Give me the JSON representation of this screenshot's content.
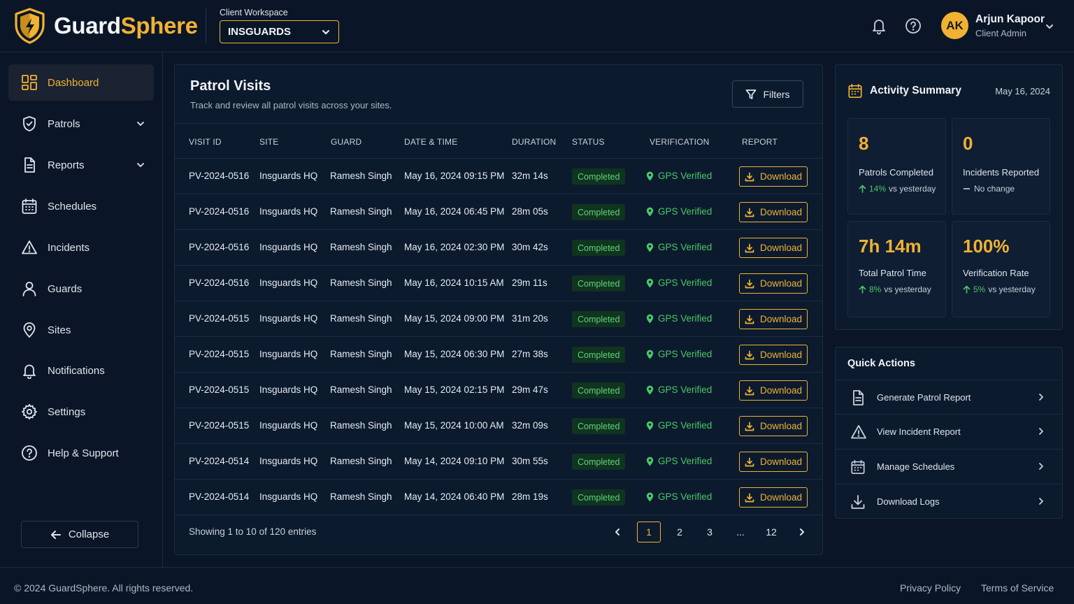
{
  "brand": {
    "name_part1": "Guard",
    "name_part2": "Sphere",
    "accent_color": "#f1b233",
    "logo_icon": "shield-bolt-icon"
  },
  "workspace": {
    "label": "Client Workspace",
    "value": "INSGUARDS"
  },
  "user": {
    "initials": "AK",
    "name": "Arjun Kapoor",
    "role": "Client Admin"
  },
  "topbar_icons": [
    "bell-icon",
    "help-icon"
  ],
  "sidebar": {
    "items": [
      {
        "label": "Dashboard",
        "icon": "dashboard-icon",
        "active": true
      },
      {
        "label": "Patrols",
        "icon": "shield-check-icon",
        "expandable": true
      },
      {
        "label": "Reports",
        "icon": "document-icon",
        "expandable": true
      },
      {
        "label": "Schedules",
        "icon": "calendar-icon"
      },
      {
        "label": "Incidents",
        "icon": "warning-icon"
      },
      {
        "label": "Guards",
        "icon": "user-icon"
      },
      {
        "label": "Sites",
        "icon": "location-pin-icon"
      },
      {
        "label": "Notifications",
        "icon": "bell-icon"
      },
      {
        "label": "Settings",
        "icon": "gear-icon"
      },
      {
        "label": "Help & Support",
        "icon": "help-icon"
      }
    ],
    "collapse_label": "Collapse"
  },
  "patrols": {
    "title": "Patrol Visits",
    "subtitle": "Track and review all patrol visits across your sites.",
    "filters_label": "Filters",
    "columns": [
      "VISIT ID",
      "SITE",
      "GUARD",
      "DATE & TIME",
      "DURATION",
      "STATUS",
      "VERIFICATION",
      "REPORT"
    ],
    "rows": [
      {
        "id": "PV-2024-0516",
        "site": "Insguards HQ",
        "guard": "Ramesh Singh",
        "datetime": "May 16, 2024 09:15 PM",
        "duration": "32m 14s",
        "status": "Completed",
        "verification": "GPS Verified",
        "report": "Download"
      },
      {
        "id": "PV-2024-0516",
        "site": "Insguards HQ",
        "guard": "Ramesh Singh",
        "datetime": "May 16, 2024 06:45 PM",
        "duration": "28m 05s",
        "status": "Completed",
        "verification": "GPS Verified",
        "report": "Download"
      },
      {
        "id": "PV-2024-0516",
        "site": "Insguards HQ",
        "guard": "Ramesh Singh",
        "datetime": "May 16, 2024 02:30 PM",
        "duration": "30m 42s",
        "status": "Completed",
        "verification": "GPS Verified",
        "report": "Download"
      },
      {
        "id": "PV-2024-0516",
        "site": "Insguards HQ",
        "guard": "Ramesh Singh",
        "datetime": "May 16, 2024 10:15 AM",
        "duration": "29m 11s",
        "status": "Completed",
        "verification": "GPS Verified",
        "report": "Download"
      },
      {
        "id": "PV-2024-0515",
        "site": "Insguards HQ",
        "guard": "Ramesh Singh",
        "datetime": "May 15, 2024 09:00 PM",
        "duration": "31m 20s",
        "status": "Completed",
        "verification": "GPS Verified",
        "report": "Download"
      },
      {
        "id": "PV-2024-0515",
        "site": "Insguards HQ",
        "guard": "Ramesh Singh",
        "datetime": "May 15, 2024 06:30 PM",
        "duration": "27m 38s",
        "status": "Completed",
        "verification": "GPS Verified",
        "report": "Download"
      },
      {
        "id": "PV-2024-0515",
        "site": "Insguards HQ",
        "guard": "Ramesh Singh",
        "datetime": "May 15, 2024 02:15 PM",
        "duration": "29m 47s",
        "status": "Completed",
        "verification": "GPS Verified",
        "report": "Download"
      },
      {
        "id": "PV-2024-0515",
        "site": "Insguards HQ",
        "guard": "Ramesh Singh",
        "datetime": "May 15, 2024 10:00 AM",
        "duration": "32m 09s",
        "status": "Completed",
        "verification": "GPS Verified",
        "report": "Download"
      },
      {
        "id": "PV-2024-0514",
        "site": "Insguards HQ",
        "guard": "Ramesh Singh",
        "datetime": "May 14, 2024 09:10 PM",
        "duration": "30m 55s",
        "status": "Completed",
        "verification": "GPS Verified",
        "report": "Download"
      },
      {
        "id": "PV-2024-0514",
        "site": "Insguards HQ",
        "guard": "Ramesh Singh",
        "datetime": "May 14, 2024 06:40 PM",
        "duration": "28m 19s",
        "status": "Completed",
        "verification": "GPS Verified",
        "report": "Download"
      }
    ],
    "showing": "Showing 1 to 10 of 120 entries",
    "pages": [
      "1",
      "2",
      "3",
      "...",
      "12"
    ],
    "current_page": "1"
  },
  "summary": {
    "title": "Activity Summary",
    "date": "May 16, 2024",
    "stats": [
      {
        "value": "8",
        "label": "Patrols Completed",
        "trend_pct": "14%",
        "trend_text": "vs yesterday",
        "trend": "up"
      },
      {
        "value": "0",
        "label": "Incidents Reported",
        "trend_pct": "",
        "trend_text": "No change",
        "trend": "flat"
      },
      {
        "value": "7h 14m",
        "label": "Total Patrol Time",
        "trend_pct": "8%",
        "trend_text": "vs yesterday",
        "trend": "up"
      },
      {
        "value": "100%",
        "label": "Verification Rate",
        "trend_pct": "5%",
        "trend_text": "vs yesterday",
        "trend": "up"
      }
    ]
  },
  "quick_actions": {
    "title": "Quick Actions",
    "items": [
      {
        "label": "Generate Patrol Report",
        "icon": "document-icon"
      },
      {
        "label": "View Incident Report",
        "icon": "warning-icon"
      },
      {
        "label": "Manage Schedules",
        "icon": "calendar-icon"
      },
      {
        "label": "Download Logs",
        "icon": "download-icon"
      }
    ]
  },
  "footer": {
    "copyright": "© 2024 GuardSphere. All rights reserved.",
    "privacy": "Privacy Policy",
    "terms": "Terms of Service"
  },
  "colors": {
    "accent": "#f1b233",
    "success": "#4cc766",
    "background": "#0a1628",
    "panel": "#0c1a2e"
  }
}
